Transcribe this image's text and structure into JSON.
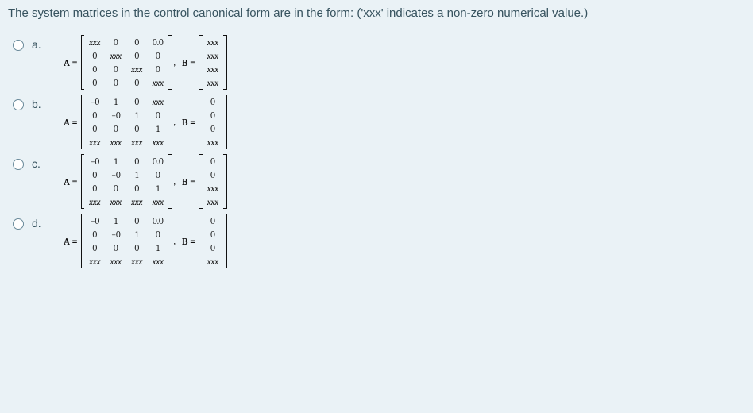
{
  "question": "The system matrices in the control canonical form are in the form: ('xxx' indicates a non-zero numerical value.)",
  "labels": {
    "A": "A =",
    "B": "B =",
    "comma": ","
  },
  "options": [
    {
      "key": "a.",
      "A": [
        [
          "xxx",
          "0",
          "0",
          "0.0"
        ],
        [
          "0",
          "xxx",
          "0",
          "0"
        ],
        [
          "0",
          "0",
          "xxx",
          "0"
        ],
        [
          "0",
          "0",
          "0",
          "xxx"
        ]
      ],
      "B": [
        [
          "xxx"
        ],
        [
          "xxx"
        ],
        [
          "xxx"
        ],
        [
          "xxx"
        ]
      ]
    },
    {
      "key": "b.",
      "A": [
        [
          "−0",
          "1",
          "0",
          "xxx"
        ],
        [
          "0",
          "−0",
          "1",
          "0"
        ],
        [
          "0",
          "0",
          "0",
          "1"
        ],
        [
          "xxx",
          "xxx",
          "xxx",
          "xxx"
        ]
      ],
      "B": [
        [
          "0"
        ],
        [
          "0"
        ],
        [
          "0"
        ],
        [
          "xxx"
        ]
      ]
    },
    {
      "key": "c.",
      "A": [
        [
          "−0",
          "1",
          "0",
          "0.0"
        ],
        [
          "0",
          "−0",
          "1",
          "0"
        ],
        [
          "0",
          "0",
          "0",
          "1"
        ],
        [
          "xxx",
          "xxx",
          "xxx",
          "xxx"
        ]
      ],
      "B": [
        [
          "0"
        ],
        [
          "0"
        ],
        [
          "xxx"
        ],
        [
          "xxx"
        ]
      ]
    },
    {
      "key": "d.",
      "A": [
        [
          "−0",
          "1",
          "0",
          "0.0"
        ],
        [
          "0",
          "−0",
          "1",
          "0"
        ],
        [
          "0",
          "0",
          "0",
          "1"
        ],
        [
          "xxx",
          "xxx",
          "xxx",
          "xxx"
        ]
      ],
      "B": [
        [
          "0"
        ],
        [
          "0"
        ],
        [
          "0"
        ],
        [
          "xxx"
        ]
      ]
    }
  ]
}
